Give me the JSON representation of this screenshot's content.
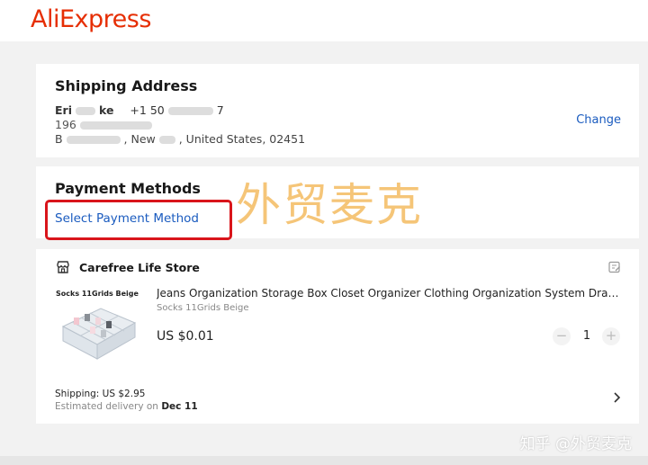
{
  "header": {
    "logo_text": "AliExpress"
  },
  "shipping": {
    "title": "Shipping Address",
    "name_visible": "Eri",
    "name_visible_2": "ke",
    "phone_visible": "+1 50",
    "phone_visible_2": "7",
    "line2_visible": "196",
    "line3_visible_start": "B",
    "line3_visible_mid": ", New",
    "line3_visible_end": ", United States, 02451",
    "change_label": "Change"
  },
  "payment": {
    "title": "Payment Methods",
    "select_label": "Select Payment Method",
    "overlay_text": "外贸麦克"
  },
  "store": {
    "name": "Carefree Life Store",
    "product": {
      "image_label": "Socks 11Grids Beige",
      "title": "Jeans Organization Storage Box Closet Organizer Clothing Organization System Drawer Organizer",
      "variant": "Socks 11Grids Beige",
      "price": "US $0.01",
      "quantity": "1",
      "minus_label": "−",
      "plus_label": "+"
    },
    "shipping_fee": "Shipping: US $2.95",
    "delivery_prefix": "Estimated delivery on",
    "delivery_date": "Dec 11"
  },
  "watermark": {
    "text": "知乎 @外贸麦克"
  },
  "colors": {
    "brand": "#e62e04",
    "link": "#1a5bbf",
    "highlight_box": "#d9151b"
  }
}
